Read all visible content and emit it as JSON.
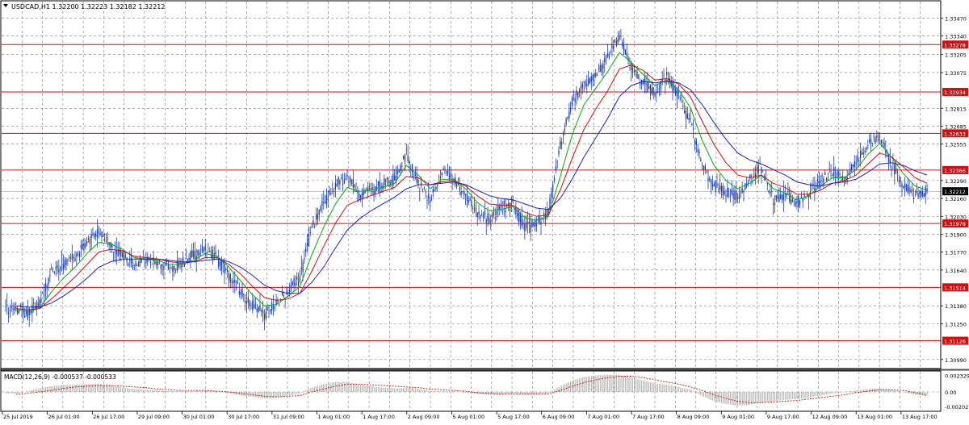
{
  "header": {
    "symbol_label": "USDCAD,H1  1.32200 1.32223 1.32182 1.32212",
    "macd_label": "MACD(12,26,9) -0.000537 -0.000533"
  },
  "colors": {
    "candle": "#1f3fb0",
    "ma_fast": "#00b000",
    "ma_mid": "#d01010",
    "ma_slow": "#2020c0",
    "level_line": "#d01010",
    "level_label_bg": "#d01010",
    "current_price_bg": "#000000",
    "macd_hist": "#9a9a9a",
    "macd_signal": "#d01010",
    "grid": "#7a7a7a"
  },
  "chart_data": [
    {
      "type": "candlestick",
      "symbol": "USDCAD",
      "timeframe": "H1",
      "ohlc_last": {
        "open": 1.322,
        "high": 1.32223,
        "low": 1.32182,
        "close": 1.32212
      },
      "current_price": "1.32212",
      "ylim": [
        1.3093,
        1.3359
      ],
      "y_ticks": [
        "1.33470",
        "1.33340",
        "1.33205",
        "1.33075",
        "1.32815",
        "1.32685",
        "1.32555",
        "1.32290",
        "1.32160",
        "1.32030",
        "1.31900",
        "1.31770",
        "1.31640",
        "1.31380",
        "1.31250",
        "1.30990"
      ],
      "x_ticks": [
        "25 Jul 2019",
        "26 Jul 01:00",
        "26 Jul 17:00",
        "29 Jul 09:00",
        "30 Jul 01:00",
        "30 Jul 17:00",
        "31 Jul 09:00",
        "1 Aug 01:00",
        "1 Aug 17:00",
        "2 Aug 09:00",
        "5 Aug 01:00",
        "5 Aug 17:00",
        "6 Aug 09:00",
        "7 Aug 01:00",
        "7 Aug 17:00",
        "8 Aug 09:00",
        "9 Aug 01:00",
        "9 Aug 17:00",
        "12 Aug 09:00",
        "13 Aug 01:00",
        "13 Aug 17:00"
      ],
      "horizontal_levels": [
        "1.33278",
        "1.32934",
        "1.32633",
        "1.32366",
        "1.31978",
        "1.31514",
        "1.31126"
      ],
      "series": [
        {
          "values": [
            1.3136,
            1.3132,
            1.314,
            1.3163,
            1.3168,
            1.3173,
            1.3185,
            1.3192,
            1.3182,
            1.3175,
            1.3168,
            1.3172,
            1.317,
            1.3166,
            1.3168,
            1.3175,
            1.318,
            1.3172,
            1.316,
            1.3148,
            1.3138,
            1.3132,
            1.314,
            1.315,
            1.3158,
            1.3195,
            1.3212,
            1.3225,
            1.3233,
            1.3218,
            1.3222,
            1.3225,
            1.323,
            1.3248,
            1.3228,
            1.3215,
            1.3235,
            1.323,
            1.3218,
            1.3205,
            1.3202,
            1.321,
            1.3212,
            1.3195,
            1.3198,
            1.3205,
            1.3255,
            1.3285,
            1.33,
            1.3305,
            1.3318,
            1.3335,
            1.331,
            1.33,
            1.3292,
            1.3305,
            1.329,
            1.3272,
            1.324,
            1.3225,
            1.322,
            1.3218,
            1.323,
            1.3238,
            1.3215,
            1.3218,
            1.3212,
            1.322,
            1.323,
            1.3235,
            1.323,
            1.3242,
            1.3255,
            1.3262,
            1.324,
            1.3226,
            1.3218,
            1.3221
          ]
        }
      ],
      "moving_averages": [
        {
          "color": "ma_fast",
          "values": [
            1.3135,
            1.3134,
            1.3136,
            1.3148,
            1.3158,
            1.3166,
            1.3176,
            1.3184,
            1.3183,
            1.3179,
            1.3173,
            1.3172,
            1.3171,
            1.3168,
            1.3168,
            1.3171,
            1.3176,
            1.3174,
            1.3166,
            1.3156,
            1.3146,
            1.3138,
            1.3139,
            1.3145,
            1.3152,
            1.3175,
            1.3195,
            1.3212,
            1.3224,
            1.3221,
            1.3222,
            1.3224,
            1.3227,
            1.324,
            1.3233,
            1.3223,
            1.323,
            1.323,
            1.3223,
            1.3213,
            1.3207,
            1.3208,
            1.321,
            1.3202,
            1.32,
            1.3203,
            1.3232,
            1.3262,
            1.3284,
            1.3296,
            1.3308,
            1.3322,
            1.3315,
            1.3306,
            1.3298,
            1.3302,
            1.3295,
            1.3282,
            1.3258,
            1.324,
            1.3229,
            1.3223,
            1.3227,
            1.3233,
            1.3223,
            1.322,
            1.3215,
            1.3218,
            1.3225,
            1.3231,
            1.3231,
            1.3237,
            1.3248,
            1.3256,
            1.3246,
            1.3234,
            1.3225,
            1.3222
          ]
        },
        {
          "color": "ma_mid",
          "values": [
            1.3136,
            1.3135,
            1.3136,
            1.3143,
            1.3151,
            1.3159,
            1.3168,
            1.3177,
            1.3179,
            1.3178,
            1.3174,
            1.3173,
            1.3172,
            1.317,
            1.3169,
            1.317,
            1.3173,
            1.3173,
            1.3168,
            1.3161,
            1.3152,
            1.3144,
            1.3142,
            1.3143,
            1.3147,
            1.3163,
            1.3181,
            1.3198,
            1.3211,
            1.3215,
            1.3218,
            1.3221,
            1.3224,
            1.3232,
            1.3231,
            1.3226,
            1.3228,
            1.3229,
            1.3225,
            1.3218,
            1.3212,
            1.3211,
            1.3211,
            1.3206,
            1.3203,
            1.3204,
            1.3222,
            1.3245,
            1.3266,
            1.3281,
            1.3294,
            1.331,
            1.3313,
            1.3309,
            1.3302,
            1.3303,
            1.3299,
            1.329,
            1.3272,
            1.3255,
            1.3242,
            1.3233,
            1.3231,
            1.3233,
            1.3227,
            1.3224,
            1.3219,
            1.3219,
            1.3222,
            1.3227,
            1.3229,
            1.3233,
            1.3241,
            1.3249,
            1.3246,
            1.3239,
            1.3231,
            1.3227
          ]
        },
        {
          "color": "ma_slow",
          "values": [
            1.3138,
            1.3137,
            1.3137,
            1.314,
            1.3145,
            1.3151,
            1.3158,
            1.3166,
            1.317,
            1.3172,
            1.3172,
            1.3172,
            1.3172,
            1.3171,
            1.317,
            1.317,
            1.3171,
            1.3172,
            1.317,
            1.3166,
            1.316,
            1.3153,
            1.3149,
            1.3147,
            1.3147,
            1.3155,
            1.3166,
            1.318,
            1.3193,
            1.3201,
            1.3207,
            1.3212,
            1.3217,
            1.3223,
            1.3226,
            1.3226,
            1.3227,
            1.3228,
            1.3226,
            1.3222,
            1.3218,
            1.3216,
            1.3215,
            1.3212,
            1.3209,
            1.3208,
            1.3216,
            1.323,
            1.3246,
            1.326,
            1.3274,
            1.329,
            1.3298,
            1.3301,
            1.33,
            1.3301,
            1.33,
            1.3295,
            1.3284,
            1.3271,
            1.3259,
            1.3249,
            1.3244,
            1.3241,
            1.3237,
            1.3233,
            1.3228,
            1.3226,
            1.3225,
            1.3227,
            1.3228,
            1.323,
            1.3235,
            1.3241,
            1.3242,
            1.324,
            1.3236,
            1.3233
          ]
        }
      ]
    },
    {
      "type": "bar",
      "indicator": "MACD(12,26,9)",
      "main": -0.000537,
      "signal": -0.000533,
      "ylim": [
        -0.0024,
        0.0026
      ],
      "y_ticks": [
        "0.002329",
        "0.00",
        "-0.002027"
      ],
      "values": [
        -0.0002,
        0.0001,
        0.0005,
        0.0008,
        0.001,
        0.001,
        0.0011,
        0.0011,
        0.0009,
        0.0006,
        0.0004,
        0.0003,
        0.0002,
        0.0001,
        0.0001,
        0.0001,
        0.0002,
        0.0001,
        -0.0002,
        -0.0005,
        -0.0007,
        -0.0009,
        -0.0008,
        -0.0005,
        -0.0002,
        0.0006,
        0.0011,
        0.0014,
        0.0014,
        0.001,
        0.0008,
        0.0006,
        0.0005,
        0.0006,
        0.0004,
        0.0001,
        0.0001,
        0.0001,
        -0.0001,
        -0.0003,
        -0.0004,
        -0.0003,
        -0.0002,
        -0.0003,
        -0.0003,
        -0.0002,
        0.0008,
        0.0016,
        0.0021,
        0.0023,
        0.0024,
        0.0024,
        0.002,
        0.0016,
        0.0012,
        0.001,
        0.0007,
        0.0003,
        -0.0006,
        -0.0013,
        -0.0017,
        -0.0019,
        -0.0018,
        -0.0015,
        -0.0013,
        -0.0011,
        -0.001,
        -0.0008,
        -0.0005,
        -0.0002,
        0.0,
        0.0002,
        0.0004,
        0.0005,
        0.0003,
        0.0,
        -0.0004,
        -0.0005
      ],
      "signal_values": [
        -0.0003,
        -0.0002,
        0.0,
        0.0002,
        0.0005,
        0.0007,
        0.0008,
        0.0009,
        0.0009,
        0.0008,
        0.0007,
        0.0006,
        0.0004,
        0.0003,
        0.0002,
        0.0002,
        0.0002,
        0.0001,
        0.0,
        -0.0002,
        -0.0004,
        -0.0006,
        -0.0007,
        -0.0006,
        -0.0005,
        0.0,
        0.0004,
        0.0008,
        0.0011,
        0.0011,
        0.001,
        0.0009,
        0.0008,
        0.0007,
        0.0006,
        0.0004,
        0.0003,
        0.0002,
        0.0001,
        -0.0001,
        -0.0002,
        -0.0003,
        -0.0003,
        -0.0003,
        -0.0003,
        -0.0003,
        0.0002,
        0.0008,
        0.0013,
        0.0017,
        0.002,
        0.0022,
        0.0022,
        0.002,
        0.0017,
        0.0014,
        0.0011,
        0.0007,
        0.0002,
        -0.0004,
        -0.0009,
        -0.0013,
        -0.0015,
        -0.0015,
        -0.0014,
        -0.0013,
        -0.0012,
        -0.001,
        -0.0008,
        -0.0006,
        -0.0004,
        -0.0001,
        0.0001,
        0.0003,
        0.0003,
        0.0002,
        -0.0001,
        -0.0005
      ]
    }
  ]
}
